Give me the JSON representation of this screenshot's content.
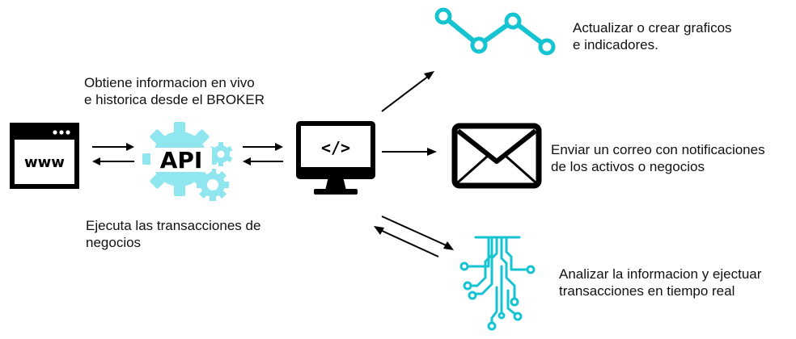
{
  "colors": {
    "accent": "#15C4D0",
    "accent_light": "#8FE6EE",
    "ink": "#000000"
  },
  "icons": {
    "browser": {
      "name": "browser-www-icon",
      "text": "www"
    },
    "api": {
      "name": "api-gears-icon",
      "text": "API"
    },
    "computer": {
      "name": "code-monitor-icon",
      "text": "</>"
    },
    "chart": {
      "name": "line-chart-icon"
    },
    "mail": {
      "name": "envelope-icon"
    },
    "circuit": {
      "name": "circuit-icon"
    }
  },
  "labels": {
    "fetch": {
      "line1": "Obtiene informacion en vivo",
      "line2": "e historica desde el BROKER"
    },
    "execute": {
      "line1": "Ejecuta las transacciones de",
      "line2": "negocios"
    },
    "charts": {
      "line1": "Actualizar o crear graficos",
      "line2": "e indicadores."
    },
    "email": {
      "line1": "Enviar un correo con notificaciones",
      "line2": "de los activos o negocios"
    },
    "analyze": {
      "line1": "Analizar la informacion y ejectuar",
      "line2": "transacciones en tiempo real"
    }
  }
}
